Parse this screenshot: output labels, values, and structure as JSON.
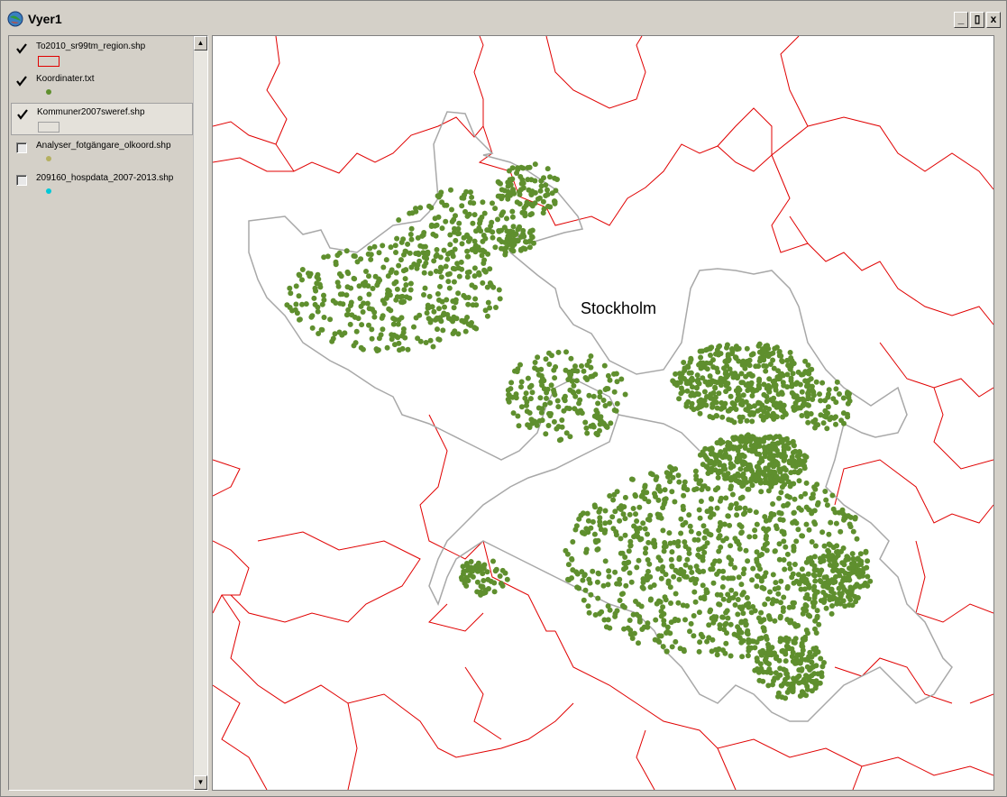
{
  "window": {
    "title": "Vyer1",
    "minimize": "_",
    "maximize": "▯",
    "close": "x"
  },
  "legend": {
    "layers": [
      {
        "name": "To2010_sr99tm_region.shp",
        "checked": true,
        "symbol": "red-outline-polygon",
        "color": "#e00000"
      },
      {
        "name": "Koordinater.txt",
        "checked": true,
        "symbol": "point",
        "color": "#5f8f2e"
      },
      {
        "name": "Kommuner2007sweref.shp",
        "checked": true,
        "symbol": "gray-outline-polygon",
        "color": "#a0a0a0"
      },
      {
        "name": "Analyser_fotgängare_olkoord.shp",
        "checked": false,
        "symbol": "point",
        "color": "#b5b060"
      },
      {
        "name": "209160_hospdata_2007-2013.shp",
        "checked": false,
        "symbol": "point",
        "color": "#00c8d8"
      }
    ]
  },
  "map": {
    "label": "Stockholm",
    "point_color": "#5f8f2e",
    "region_color": "#e00000",
    "municipality_color": "#a8a8a8"
  }
}
